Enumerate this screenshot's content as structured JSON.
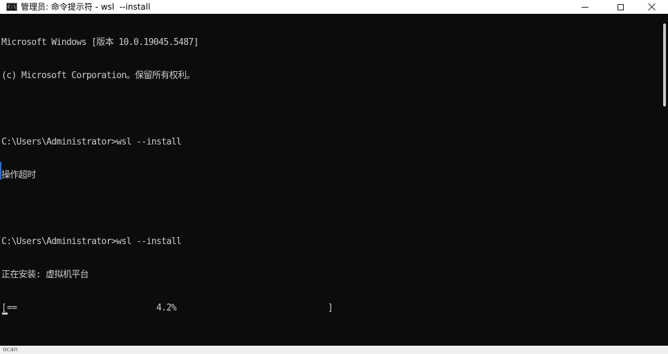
{
  "window": {
    "title": "管理员: 命令提示符 - wsl  --install",
    "app_icon_text": "C:\\",
    "icon_names": {
      "app": "cmd-app-icon",
      "minimize": "minimize-icon",
      "maximize": "maximize-icon",
      "close": "close-icon"
    }
  },
  "console": {
    "lines": [
      "Microsoft Windows [版本 10.0.19045.5487]",
      "(c) Microsoft Corporation。保留所有权利。",
      "",
      "C:\\Users\\Administrator>wsl --install",
      "操作超时",
      "",
      "C:\\Users\\Administrator>wsl --install",
      "正在安装: 虚拟机平台"
    ],
    "progress": {
      "open_bracket": "[",
      "fill": "==",
      "percent_text": "4.2%",
      "value": 0.042,
      "close_bracket": "]"
    }
  },
  "colors": {
    "console_bg": "#0c0c0c",
    "console_fg": "#cccccc",
    "titlebar_bg": "#ffffff"
  },
  "taskbar": {
    "fragment": "ocan"
  }
}
